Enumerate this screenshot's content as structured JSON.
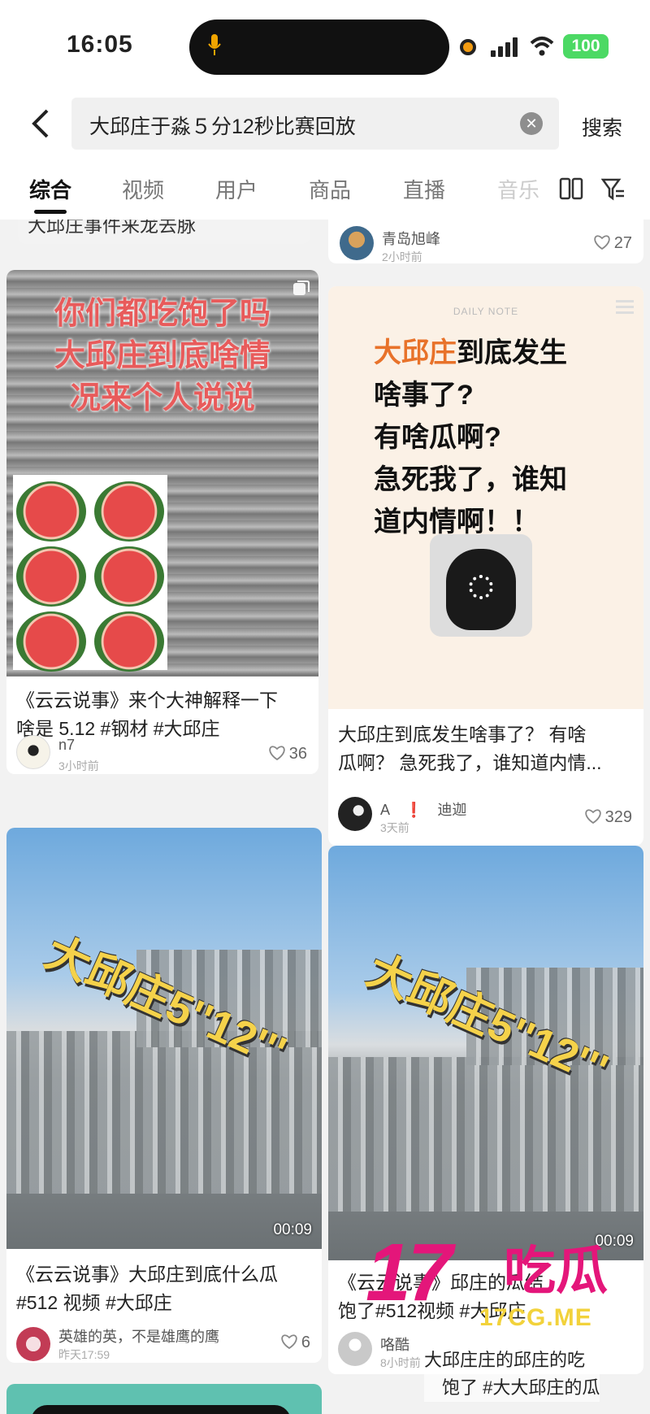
{
  "status_bar": {
    "time": "16:05",
    "battery": "100"
  },
  "search": {
    "query": "大邱庄于淼５分12秒比赛回放",
    "button": "搜索"
  },
  "tabs": [
    {
      "label": "综合"
    },
    {
      "label": "视频"
    },
    {
      "label": "用户"
    },
    {
      "label": "商品"
    },
    {
      "label": "直播"
    },
    {
      "label": "音乐"
    }
  ],
  "partial_left_title": "大邱庄事件来龙去脉",
  "partial_right": {
    "author": "青岛旭峰",
    "time": "2小时前",
    "likes": "27"
  },
  "cards": [
    {
      "cover_text": [
        "你们都吃饱了吗",
        "大邱庄到底啥情",
        "况来个人说说"
      ],
      "title": [
        "《云云说事》来个大神解释一下",
        "啥是 5.12 #钢材 #大邱庄"
      ],
      "author": "n7",
      "time": "3小时前",
      "likes": "36"
    },
    {
      "note_header": "DAILY NOTE",
      "note_lines": [
        "到底发生",
        "啥事了?",
        "有啥瓜啊?",
        "急死我了，谁知",
        "道内情啊！！"
      ],
      "note_highlight": "大邱庄",
      "title": [
        "大邱庄到底发生啥事了？ 有啥",
        "瓜啊？ 急死我了，谁知道内情..."
      ],
      "author": "A",
      "author_mark": "❗",
      "author_suffix": "迪迦",
      "time": "3天前",
      "likes": "329"
    },
    {
      "cover_text": "大邱庄5''12'''",
      "duration": "00:09",
      "title": [
        "《云云说事》大邱庄到底什么瓜",
        "#512 视频 #大邱庄"
      ],
      "author": "英雄的英，不是雄鹰的鹰",
      "time": "昨天17:59",
      "likes": "6"
    },
    {
      "cover_text": "大邱庄5''12'''",
      "duration": "00:09",
      "title": [
        "《云云说事》邱庄的瓜结",
        "饱了#512视频 #大邱庄"
      ],
      "author": "咯酷",
      "time": "8小时前"
    }
  ],
  "overlay_text": [
    "大邱庄庄的邱庄的吃",
    "饱了 #大大邱庄的瓜"
  ],
  "watermark": {
    "number": "17",
    "cn": "吃瓜",
    "url": "17CG.ME"
  },
  "colors": {
    "accent": "#e8722a",
    "watermark": "#e4167a",
    "battery": "#4cd964"
  }
}
